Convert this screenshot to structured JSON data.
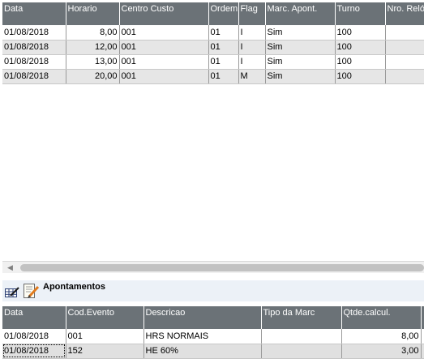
{
  "marcacoes": {
    "columns": [
      "Data",
      "Horario",
      "Centro Custo",
      "Ordem",
      "Flag",
      "Marc. Apont.",
      "Turno",
      "Nro. Relóg"
    ],
    "rows": [
      {
        "data": "01/08/2018",
        "horario": "8,00",
        "centro_custo": "001",
        "ordem": "01",
        "flag": "I",
        "marc_apont": "Sim",
        "turno": "100",
        "nro_relog": ""
      },
      {
        "data": "01/08/2018",
        "horario": "12,00",
        "centro_custo": "001",
        "ordem": "01",
        "flag": "I",
        "marc_apont": "Sim",
        "turno": "100",
        "nro_relog": ""
      },
      {
        "data": "01/08/2018",
        "horario": "13,00",
        "centro_custo": "001",
        "ordem": "01",
        "flag": "I",
        "marc_apont": "Sim",
        "turno": "100",
        "nro_relog": ""
      },
      {
        "data": "01/08/2018",
        "horario": "20,00",
        "centro_custo": "001",
        "ordem": "01",
        "flag": "M",
        "marc_apont": "Sim",
        "turno": "100",
        "nro_relog": ""
      }
    ]
  },
  "apontamentos": {
    "title": "Apontamentos",
    "columns": [
      "Data",
      "Cod.Evento",
      "Descricao",
      "Tipo da Marc",
      "Qtde.calcul.",
      ""
    ],
    "rows": [
      {
        "data": "01/08/2018",
        "cod_evento": "001",
        "descricao": "HRS NORMAIS",
        "tipo_marc": "",
        "qtde": "8,00"
      },
      {
        "data": "01/08/2018",
        "cod_evento": "152",
        "descricao": "HE 60%",
        "tipo_marc": "",
        "qtde": "3,00"
      }
    ]
  },
  "icons": {
    "section_left": "edit-grid-icon",
    "section_right": "notepad-pencil-icon",
    "scroll_left": "scroll-left-arrow-icon"
  },
  "colors": {
    "header_bg": "#6b7277",
    "section_bg": "#ecf1f7"
  }
}
